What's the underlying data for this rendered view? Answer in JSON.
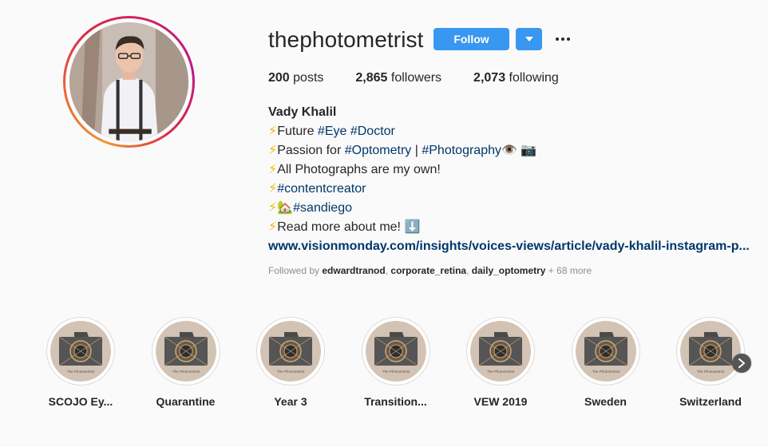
{
  "profile": {
    "username": "thephotometrist",
    "follow_label": "Follow",
    "stats": {
      "posts_count": "200",
      "posts_label": "posts",
      "followers_count": "2,865",
      "followers_label": "followers",
      "following_count": "2,073",
      "following_label": "following"
    },
    "bio": {
      "name": "Vady Khalil",
      "bolt": "⚡",
      "line1_prefix": "Future ",
      "line1_tag1": "#Eye",
      "line1_tag2": "#Doctor",
      "line2_prefix": "Passion for ",
      "line2_tag1": "#Optometry",
      "line2_sep": " | ",
      "line2_tag2": "#Photography",
      "line2_emoji": "👁️ 📷",
      "line3": "All Photographs are my own!",
      "line4_tag": "#contentcreator",
      "line5_emoji": "🏡",
      "line5_tag": "#sandiego",
      "line6": "Read more about me! ",
      "line6_emoji": "⬇️",
      "link": "www.visionmonday.com/insights/voices-views/article/vady-khalil-instagram-p..."
    },
    "followed_by": {
      "prefix": "Followed by ",
      "user1": "edwardtranod",
      "user2": "corporate_retina",
      "user3": "daily_optometry",
      "suffix": " + 68 more"
    }
  },
  "highlights": [
    {
      "label": "SCOJO Ey..."
    },
    {
      "label": "Quarantine"
    },
    {
      "label": "Year 3"
    },
    {
      "label": "Transition..."
    },
    {
      "label": "VEW 2019"
    },
    {
      "label": "Sweden"
    },
    {
      "label": "Switzerland"
    }
  ],
  "highlight_cover_text": "The Photometrist",
  "colors": {
    "accent": "#3897f0",
    "link": "#00376b",
    "muted": "#8e8e8e"
  }
}
